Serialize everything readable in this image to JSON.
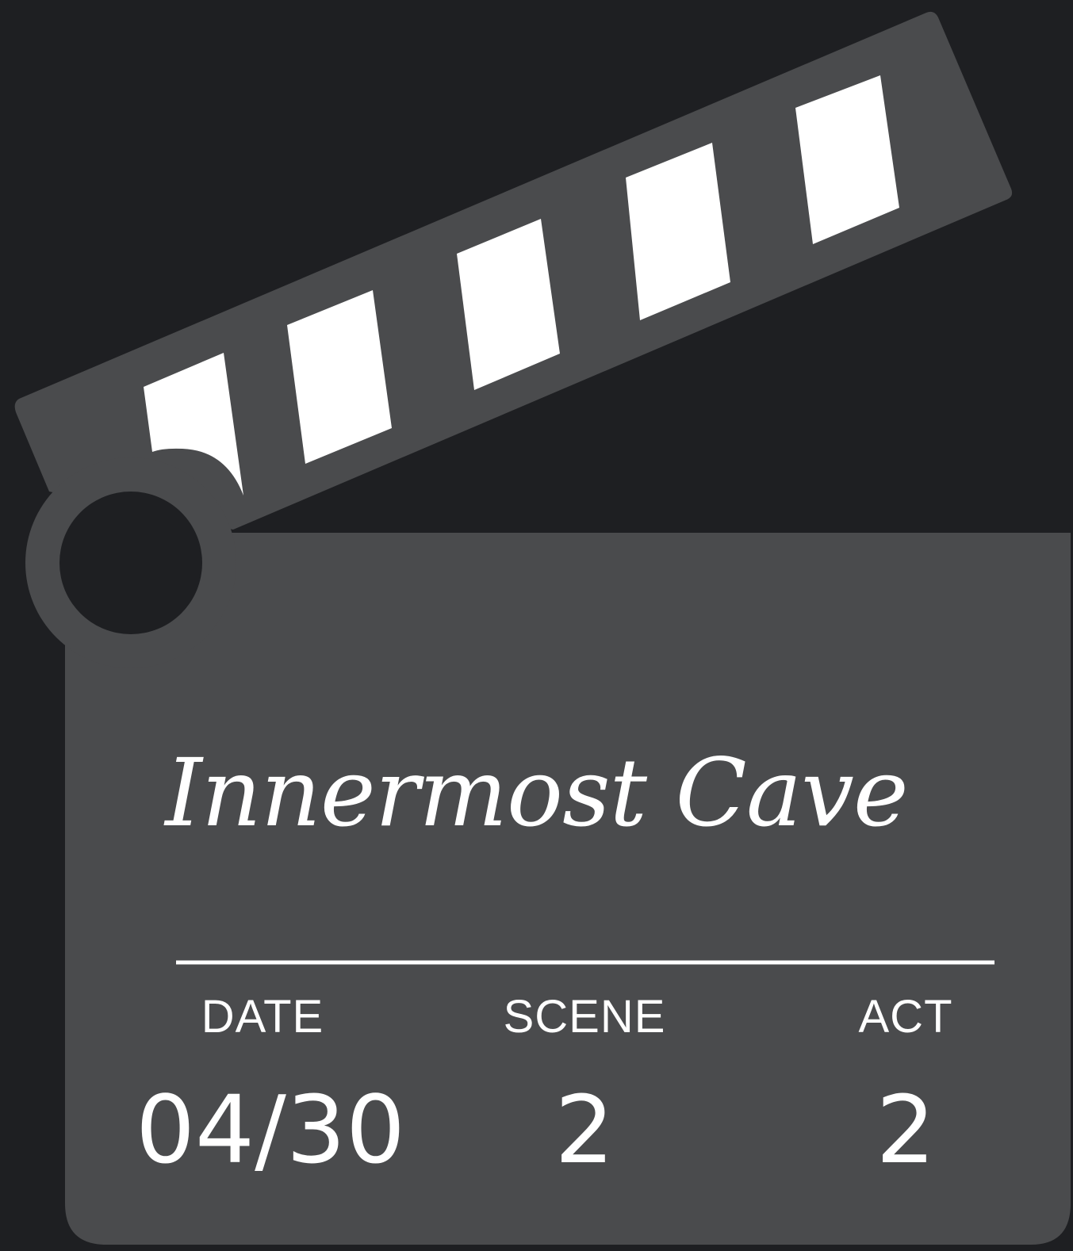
{
  "colors": {
    "background": "#1e1f22",
    "board": "#4a4b4d",
    "stripes": "#ffffff",
    "text": "#ffffff"
  },
  "clapperboard": {
    "title": "Innermost Cave",
    "fields": {
      "date_label": "DATE",
      "scene_label": "SCENE",
      "act_label": "ACT",
      "date_value": "04/30",
      "scene_value": "2",
      "act_value": "2"
    }
  },
  "icons": [
    "clapperboard-icon",
    "hinge-icon"
  ]
}
